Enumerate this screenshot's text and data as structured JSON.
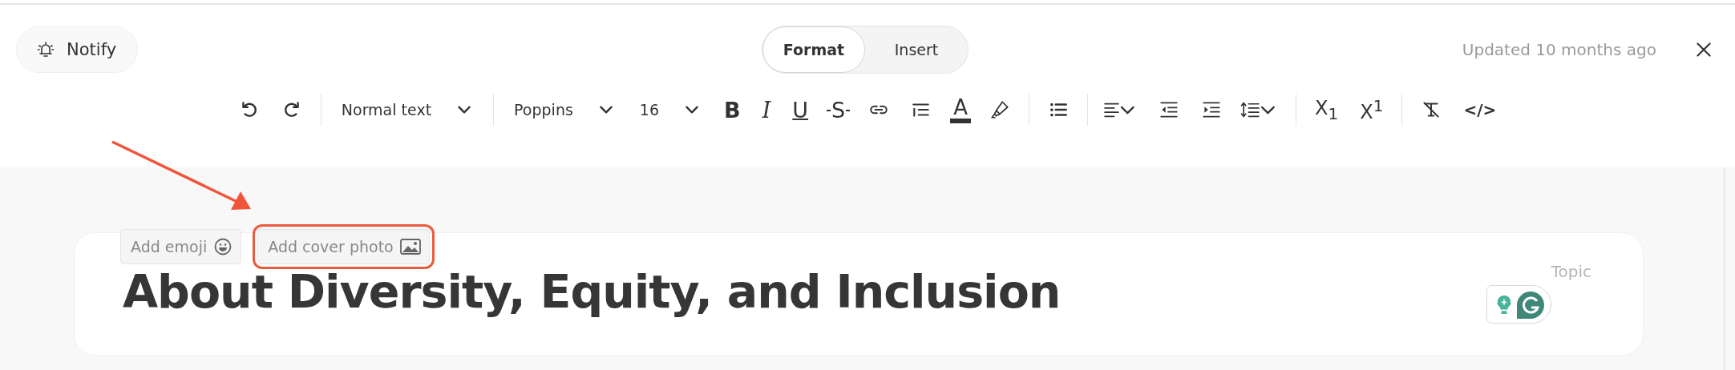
{
  "notify_button": {
    "label": "Notify"
  },
  "mode_tabs": [
    {
      "label": "Format",
      "selected": true
    },
    {
      "label": "Insert",
      "selected": false
    }
  ],
  "updated_text": "Updated 10 months ago",
  "toolbar": [
    {
      "kind": "undo"
    },
    {
      "kind": "redo"
    },
    {
      "kind": "separator"
    },
    {
      "kind": "dropdown",
      "value": "Normal text"
    },
    {
      "kind": "separator"
    },
    {
      "kind": "dropdown",
      "value": "Poppins"
    },
    {
      "kind": "dropdown",
      "value": "16"
    },
    {
      "kind": "bold",
      "text": "B"
    },
    {
      "kind": "italic",
      "text": "I"
    },
    {
      "kind": "underline",
      "text": "U"
    },
    {
      "kind": "strike",
      "text": "S"
    },
    {
      "kind": "link"
    },
    {
      "kind": "indent-list"
    },
    {
      "kind": "text-color",
      "text": "A"
    },
    {
      "kind": "highlighter"
    },
    {
      "kind": "separator"
    },
    {
      "kind": "bullets"
    },
    {
      "kind": "separator"
    },
    {
      "kind": "align"
    },
    {
      "kind": "outdent"
    },
    {
      "kind": "indent"
    },
    {
      "kind": "line-spacing"
    },
    {
      "kind": "separator"
    },
    {
      "kind": "subscript",
      "text": "X$_{1}$"
    },
    {
      "kind": "superscript",
      "text": "X$^{1}$"
    },
    {
      "kind": "separator"
    },
    {
      "kind": "clear-format"
    },
    {
      "kind": "code",
      "text": "</>"
    }
  ],
  "add_buttons": [
    {
      "kind": "emoji",
      "label": "Add emoji",
      "highlighted": false
    },
    {
      "kind": "cover",
      "label": "Add cover photo",
      "highlighted": true
    }
  ],
  "title": "About Diversity, Equity, and Inclusion",
  "topic_placeholder": "Topic"
}
